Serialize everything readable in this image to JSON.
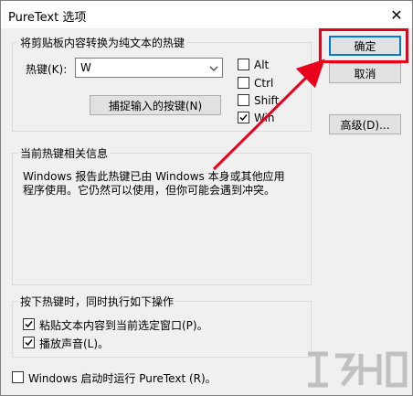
{
  "window": {
    "title": "PureText 选项",
    "close_glyph": "✕"
  },
  "hotkey_group": {
    "title": "将剪贴板内容转换为纯文本的热键",
    "hotkey_label": "热键(K):",
    "hotkey_value": "W",
    "capture_button": "捕捉输入的按键(N)",
    "modifiers": [
      {
        "label": "Alt",
        "checked": false
      },
      {
        "label": "Ctrl",
        "checked": false
      },
      {
        "label": "Shift",
        "checked": false
      },
      {
        "label": "Win",
        "checked": true
      }
    ]
  },
  "info_group": {
    "title": "当前热键相关信息",
    "text": "Windows 报告此热键已由 Windows 本身或其他应用程序使用。它仍然可以使用，但你可能会遇到冲突。"
  },
  "action_group": {
    "title": "按下热键时，同时执行如下操作",
    "options": [
      {
        "label": "粘贴文本内容到当前选定窗口(P)。",
        "checked": true
      },
      {
        "label": "播放声音(L)。",
        "checked": true
      }
    ]
  },
  "startup": {
    "label": "Windows 启动时运行 PureText (R)。",
    "checked": false
  },
  "buttons": {
    "ok": "确定",
    "cancel": "取消",
    "advanced": "高级(D)..."
  },
  "annotation": {
    "color": "#e8001c"
  }
}
